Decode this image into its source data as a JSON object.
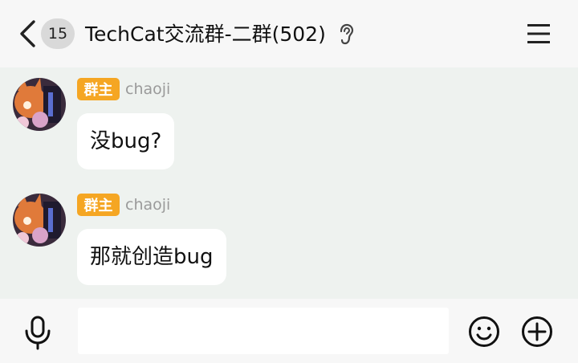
{
  "header": {
    "back_count": "15",
    "title": "TechCat交流群-二群(502)"
  },
  "messages": [
    {
      "role": "群主",
      "sender": "chaoji",
      "text": "没bug?"
    },
    {
      "role": "群主",
      "sender": "chaoji",
      "text": "那就创造bug"
    }
  ],
  "composer": {
    "value": ""
  },
  "icons": {
    "back": "chevron-left-icon",
    "ear": "ear-icon",
    "menu": "menu-icon",
    "mic": "microphone-icon",
    "emoji": "emoji-icon",
    "plus": "plus-icon"
  },
  "colors": {
    "role_badge": "#f5a623",
    "chat_bg": "#eef2ef",
    "bar_bg": "#f7f7f7"
  }
}
